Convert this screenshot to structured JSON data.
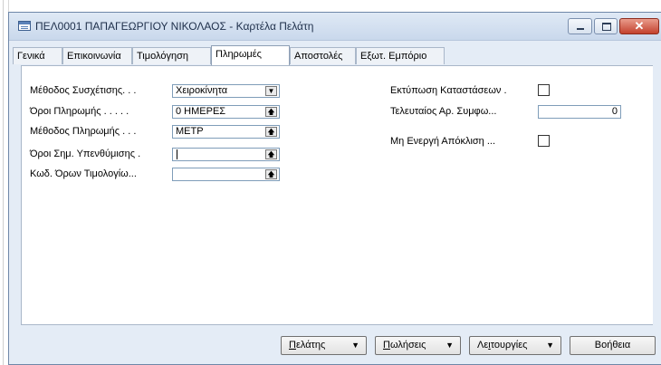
{
  "window": {
    "title": "ΠΕΛ0001 ΠΑΠΑΓΕΩΡΓΙΟΥ ΝΙΚΟΛΑΟΣ - Καρτέλα Πελάτη"
  },
  "tabs": [
    "Γενικά",
    "Επικοινωνία",
    "Τιμολόγηση",
    "Πληρωμές",
    "Αποστολές",
    "Εξωτ. Εμπόριο"
  ],
  "active_tab": "Πληρωμές",
  "fields": {
    "application_method": {
      "label": "Μέθοδος Συσχέτισης. . .",
      "value": "Χειροκίνητα",
      "button": "dropdown"
    },
    "payment_terms": {
      "label": "Όροι Πληρωμής . . . . .",
      "value": "0 ΗΜΕΡΕΣ",
      "button": "lookup"
    },
    "payment_method": {
      "label": "Μέθοδος Πληρωμής . . .",
      "value": "ΜΕΤΡ",
      "button": "lookup"
    },
    "reminder_terms": {
      "label": "Όροι Σημ. Υπενθύμισης .",
      "value": "",
      "button": "lookup"
    },
    "fin_charge_terms": {
      "label": "Κωδ. Όρων Τιμολογίω...",
      "value": "",
      "button": "lookup"
    },
    "print_statements": {
      "label": "Εκτύπωση Καταστάσεων .",
      "checked": false
    },
    "last_agreement_no": {
      "label": "Τελευταίος Αρ. Συμφω...",
      "value": "0"
    },
    "block_payment_tolerance": {
      "label": "Μη Ενεργή Απόκλιση ...",
      "checked": false
    }
  },
  "buttons": {
    "customer": {
      "label": "Πελάτης",
      "mnemonic": "Π",
      "rest": "ελάτης"
    },
    "sales": {
      "label": "Πωλήσεις",
      "mnemonic": "Π",
      "rest": "ωλήσεις"
    },
    "functions": {
      "label": "Λειτουργίες",
      "pre": "Λε",
      "mnemonic": "ι",
      "rest": "τουργίες"
    },
    "help": {
      "label": "Βοήθεια"
    }
  },
  "icons": {
    "dropdown": "chevron-down-icon",
    "lookup": "arrow-up-icon",
    "menu": "triangle-down-icon"
  }
}
